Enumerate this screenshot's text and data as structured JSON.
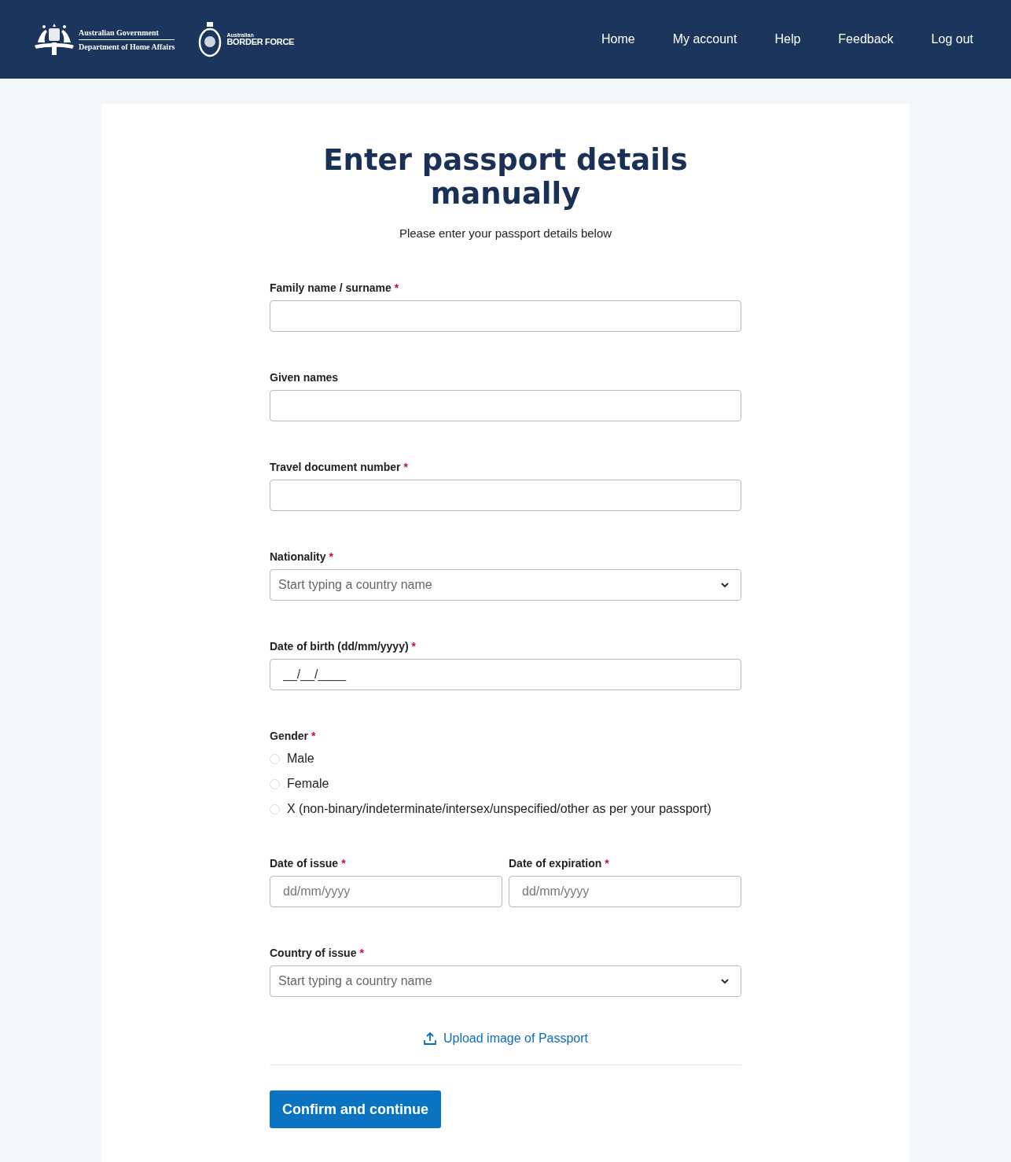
{
  "header": {
    "logo_primary": {
      "line_1": "Australian Government",
      "line_2": "Department of Home Affairs"
    },
    "logo_secondary": {
      "line_1": "Australian",
      "line_2": "BORDER FORCE"
    },
    "nav": [
      "Home",
      "My account",
      "Help",
      "Feedback",
      "Log out"
    ]
  },
  "form": {
    "title": "Enter passport details manually",
    "subtitle": "Please enter your passport details below",
    "fields": [
      {
        "kind": "text",
        "label": "Family name / surname",
        "required_mark": "*"
      },
      {
        "kind": "text",
        "label": "Given names"
      },
      {
        "kind": "text",
        "label": "Travel document number",
        "required_mark": "*"
      },
      {
        "kind": "select",
        "label": "Nationality",
        "required_mark": "*",
        "placeholder": "Start typing a country name"
      },
      {
        "kind": "text",
        "label": "Date of birth (dd/mm/yyyy)",
        "required_mark": "*",
        "value": "__/__/____"
      },
      {
        "kind": "radio",
        "label": "Gender",
        "required_mark": "*",
        "options": [
          {
            "label": "Male",
            "selected": false
          },
          {
            "label": "Female",
            "selected": false
          },
          {
            "label": "X (non-binary/indeterminate/intersex/unspecified/other as per your passport)",
            "selected": false
          }
        ]
      },
      {
        "kind": "pair",
        "items": [
          {
            "label": "Date of issue",
            "required_mark": "*",
            "placeholder": "dd/mm/yyyy"
          },
          {
            "label": "Date of expiration",
            "required_mark": "*",
            "placeholder": "dd/mm/yyyy"
          }
        ]
      },
      {
        "kind": "select",
        "label": "Country of issue",
        "required_mark": "*",
        "placeholder": "Start typing a country name"
      }
    ],
    "upload_link": "Upload image of Passport",
    "submit_button": "Confirm and continue"
  }
}
